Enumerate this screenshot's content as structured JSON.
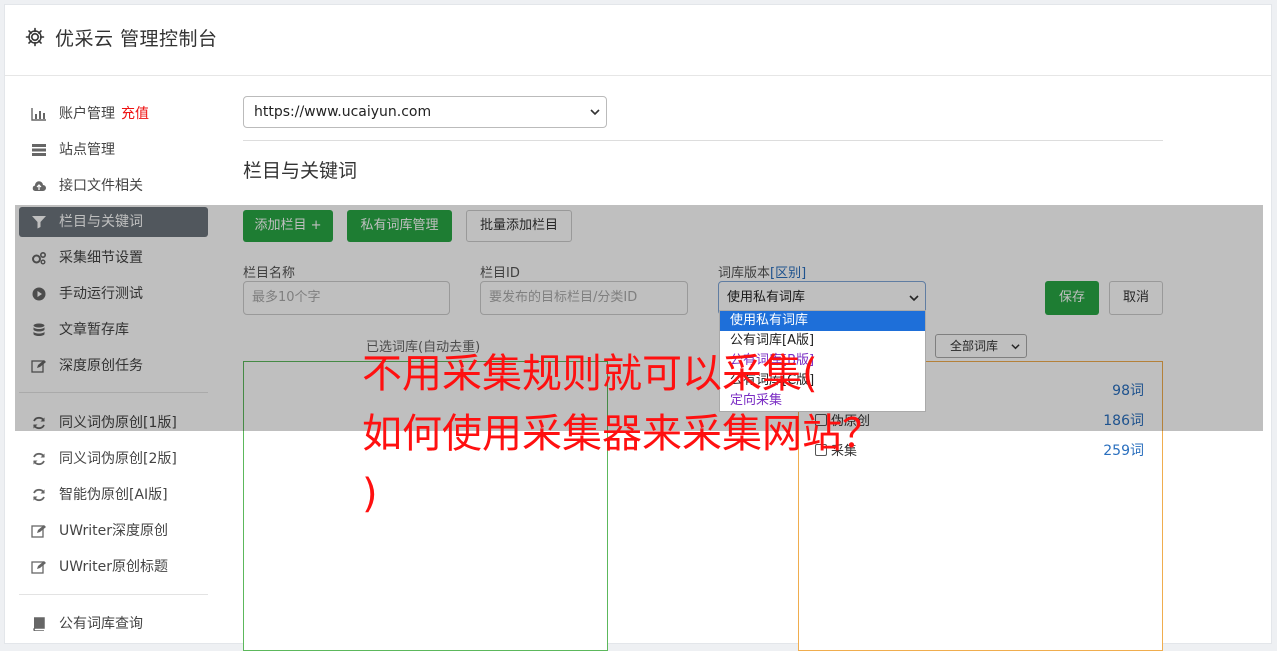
{
  "app": {
    "title": "优采云 管理控制台"
  },
  "sidebar": {
    "items": [
      {
        "label": "账户管理",
        "badge": "充值",
        "icon": "bar-chart-icon"
      },
      {
        "label": "站点管理",
        "icon": "server-icon"
      },
      {
        "label": "接口文件相关",
        "icon": "cloud-upload-icon"
      },
      {
        "label": "栏目与关键词",
        "icon": "filter-icon",
        "active": true
      },
      {
        "label": "采集细节设置",
        "icon": "cogs-icon"
      },
      {
        "label": "手动运行测试",
        "icon": "play-circle-icon"
      },
      {
        "label": "文章暂存库",
        "icon": "database-icon"
      },
      {
        "label": "深度原创任务",
        "icon": "edit-icon"
      },
      {
        "label": "同义词伪原创[1版]",
        "icon": "refresh-icon"
      },
      {
        "label": "同义词伪原创[2版]",
        "icon": "refresh-icon"
      },
      {
        "label": "智能伪原创[AI版]",
        "icon": "refresh-icon"
      },
      {
        "label": "UWriter深度原创",
        "icon": "edit-icon"
      },
      {
        "label": "UWriter原创标题",
        "icon": "edit-icon"
      },
      {
        "label": "公有词库查询",
        "icon": "book-icon"
      }
    ]
  },
  "main": {
    "site_select": "https://www.ucaiyun.com",
    "section_title": "栏目与关键词",
    "buttons": {
      "add_column": "添加栏目 +",
      "private_lib": "私有词库管理",
      "batch_add": "批量添加栏目",
      "save": "保存",
      "cancel": "取消"
    },
    "form": {
      "name_label": "栏目名称",
      "name_placeholder": "最多10个字",
      "id_label": "栏目ID",
      "id_placeholder": "要发布的目标栏目/分类ID",
      "version_label": "词库版本",
      "version_link": "[区别]",
      "version_value": "使用私有词库"
    },
    "dropdown_options": [
      {
        "label": "使用私有词库",
        "highlighted": true
      },
      {
        "label": "公有词库[A版]"
      },
      {
        "label": "公有词库[B版]",
        "purple": true
      },
      {
        "label": "公有词库[C版]"
      },
      {
        "label": "定向采集",
        "purple": true
      }
    ],
    "selected_label": "已选词库(自动去重)",
    "lib_filter": "全部词库",
    "libraries": [
      {
        "name": "",
        "count": "98词"
      },
      {
        "name": "伪原创",
        "count": "186词"
      },
      {
        "name": "采集",
        "count": "259词"
      }
    ]
  },
  "headline": "不用采集规则就可以采集(\n如何使用采集器来采集网站？\n)",
  "colors": {
    "active_bg": "#6c757d",
    "green": "#28a745",
    "headline": "#ff1010"
  }
}
